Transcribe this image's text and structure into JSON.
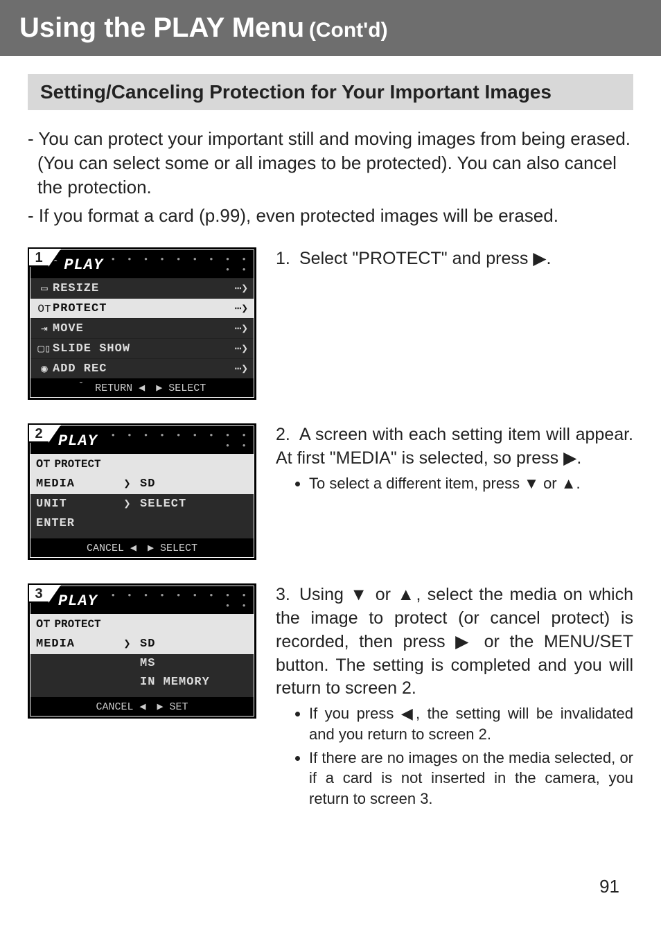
{
  "title": {
    "main": "Using the PLAY Menu",
    "sub": "(Cont'd)"
  },
  "section_header": "Setting/Canceling Protection for Your Important Images",
  "intro": [
    "- You can protect your important still and moving images from being erased. (You can select some or all images to be protected). You can also cancel the protection.",
    "- If you format a card (p.99), even protected images will be erased."
  ],
  "panels": {
    "p1": {
      "num": "1",
      "header": "PLAY",
      "rows": [
        {
          "icon": "▭",
          "label": "RESIZE",
          "arrow": "⋯❯",
          "inv": false
        },
        {
          "icon": "O⊤",
          "label": "PROTECT",
          "arrow": "⋯❯",
          "inv": true
        },
        {
          "icon": "⇥",
          "label": "MOVE",
          "arrow": "⋯❯",
          "inv": false
        },
        {
          "icon": "▢▯",
          "label": "SLIDE SHOW",
          "arrow": "⋯❯",
          "inv": false
        },
        {
          "icon": "◉",
          "label": "ADD REC",
          "arrow": "⋯❯",
          "inv": false
        }
      ],
      "footer": {
        "left": "RETURN ◀",
        "right": "▶ SELECT"
      },
      "caret_top": "ˆ",
      "caret_bot": "ˇ"
    },
    "p2": {
      "num": "2",
      "header": "PLAY",
      "sub": "PROTECT",
      "rows": [
        {
          "c1": "MEDIA",
          "mid": "❯",
          "c2": "SD",
          "inv": true
        },
        {
          "c1": "UNIT",
          "mid": "❯",
          "c2": "SELECT",
          "inv": false
        },
        {
          "c1": "ENTER",
          "mid": "",
          "c2": "",
          "inv": false
        },
        {
          "c1": " ",
          "mid": "",
          "c2": "",
          "inv": false
        }
      ],
      "footer": {
        "left": "CANCEL ◀",
        "right": "▶ SELECT"
      }
    },
    "p3": {
      "num": "3",
      "header": "PLAY",
      "sub": "PROTECT",
      "rows": [
        {
          "c1": "MEDIA",
          "mid": "❯",
          "c2": "SD",
          "inv": true
        },
        {
          "c1": "",
          "mid": "",
          "c2": "MS",
          "inv": false
        },
        {
          "c1": "",
          "mid": "",
          "c2": "IN MEMORY",
          "inv": false
        },
        {
          "c1": " ",
          "mid": "",
          "c2": "",
          "inv": false
        }
      ],
      "footer": {
        "left": "CANCEL ◀",
        "right": "▶ SET"
      }
    }
  },
  "steps": {
    "s1": {
      "n": "1.",
      "text": "Select \"PROTECT\" and press ▶."
    },
    "s2": {
      "n": "2.",
      "text": "A screen with each setting item will appear. At first \"MEDIA\" is selected, so press ▶.",
      "bullets": [
        "To select a different item, press ▼ or ▲."
      ]
    },
    "s3": {
      "n": "3.",
      "text": "Using ▼ or ▲, select the media on which the image to protect (or cancel protect) is recorded, then press ▶ or the MENU/SET button. The setting is completed and you will return to screen 2.",
      "bullets": [
        "If you press ◀, the setting will be invalidated and you return to screen 2.",
        "If there are no images on the media selected, or if a card is not inserted in the camera, you return to screen 3."
      ]
    }
  },
  "page_num": "91"
}
